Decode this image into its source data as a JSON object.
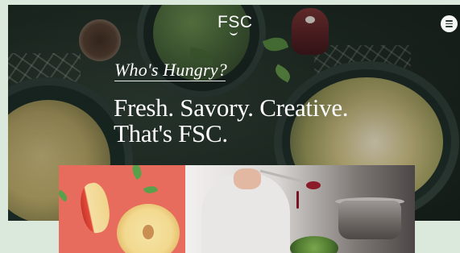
{
  "header": {
    "logo_text": "FSC",
    "menu_icon": "hamburger-menu-icon"
  },
  "hero": {
    "tagline": "Who's Hungry?",
    "headline_line1": "Fresh. Savory. Creative.",
    "headline_line2": "That's FSC."
  },
  "colors": {
    "page_background": "#dbe9dc",
    "hero_dark_green": "#1d2922",
    "text_white": "#ffffff",
    "apple_panel_coral": "#e86c5e"
  }
}
